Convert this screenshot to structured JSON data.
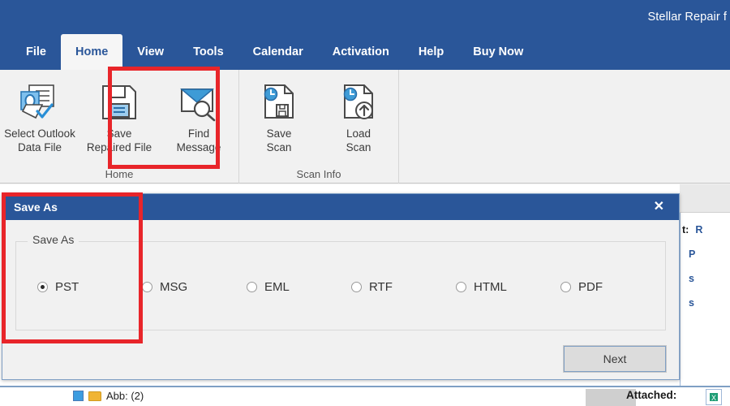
{
  "window": {
    "title": "Stellar Repair f",
    "accent_blue": "#2a5699",
    "annotation_red": "#e8252a"
  },
  "tabs": [
    {
      "label": "File",
      "active": false
    },
    {
      "label": "Home",
      "active": true
    },
    {
      "label": "View",
      "active": false
    },
    {
      "label": "Tools",
      "active": false
    },
    {
      "label": "Calendar",
      "active": false
    },
    {
      "label": "Activation",
      "active": false
    },
    {
      "label": "Help",
      "active": false
    },
    {
      "label": "Buy Now",
      "active": false
    }
  ],
  "ribbon": {
    "groups": [
      {
        "label": "Home",
        "buttons": [
          {
            "line1": "Select Outlook",
            "line2": "Data File",
            "icon": "select-outlook-data-file-icon"
          },
          {
            "line1": "Save",
            "line2": "Repaired File",
            "icon": "floppy-disk-save-icon"
          },
          {
            "line1": "Find",
            "line2": "Message",
            "icon": "envelope-search-icon"
          }
        ]
      },
      {
        "label": "Scan Info",
        "buttons": [
          {
            "line1": "Save",
            "line2": "Scan",
            "icon": "document-save-scan-icon"
          },
          {
            "line1": "Load",
            "line2": "Scan",
            "icon": "document-load-scan-icon"
          }
        ]
      }
    ]
  },
  "dialog": {
    "title": "Save As",
    "close_label": "✕",
    "group_legend": "Save As",
    "options": [
      {
        "label": "PST",
        "checked": true
      },
      {
        "label": "MSG",
        "checked": false
      },
      {
        "label": "EML",
        "checked": false
      },
      {
        "label": "RTF",
        "checked": false
      },
      {
        "label": "HTML",
        "checked": false
      },
      {
        "label": "PDF",
        "checked": false
      }
    ],
    "next_label": "Next"
  },
  "background": {
    "detail_rows": [
      {
        "key": "t:",
        "value": "R"
      },
      {
        "key": "",
        "value": "P"
      },
      {
        "key": "",
        "value": "s"
      },
      {
        "key": "",
        "value": "s"
      }
    ],
    "attached_label": "Attached:",
    "tree_item_label": "Abb: (2)"
  }
}
